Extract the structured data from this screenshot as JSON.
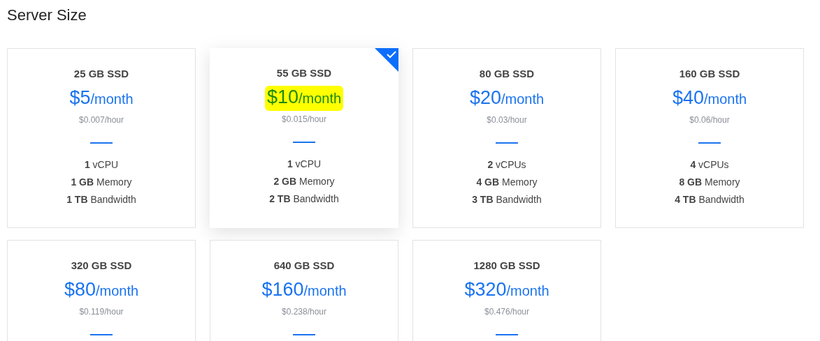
{
  "title": "Server Size",
  "plans": [
    {
      "storage": "25 GB SSD",
      "price": "$5",
      "period": "/month",
      "hourly": "$0.007/hour",
      "selected": false,
      "highlighted": false,
      "specs": [
        "**1** vCPU",
        "**1 GB** Memory",
        "**1 TB** Bandwidth"
      ]
    },
    {
      "storage": "55 GB SSD",
      "price": "$10",
      "period": "/month",
      "hourly": "$0.015/hour",
      "selected": true,
      "highlighted": true,
      "specs": [
        "**1** vCPU",
        "**2 GB** Memory",
        "**2 TB** Bandwidth"
      ]
    },
    {
      "storage": "80 GB SSD",
      "price": "$20",
      "period": "/month",
      "hourly": "$0.03/hour",
      "selected": false,
      "highlighted": false,
      "specs": [
        "**2** vCPUs",
        "**4 GB** Memory",
        "**3 TB** Bandwidth"
      ]
    },
    {
      "storage": "160 GB SSD",
      "price": "$40",
      "period": "/month",
      "hourly": "$0.06/hour",
      "selected": false,
      "highlighted": false,
      "specs": [
        "**4** vCPUs",
        "**8 GB** Memory",
        "**4 TB** Bandwidth"
      ]
    },
    {
      "storage": "320 GB SSD",
      "price": "$80",
      "period": "/month",
      "hourly": "$0.119/hour",
      "selected": false,
      "highlighted": false
    },
    {
      "storage": "640 GB SSD",
      "price": "$160",
      "period": "/month",
      "hourly": "$0.238/hour",
      "selected": false,
      "highlighted": false
    },
    {
      "storage": "1280 GB SSD",
      "price": "$320",
      "period": "/month",
      "hourly": "$0.476/hour",
      "selected": false,
      "highlighted": false
    }
  ]
}
